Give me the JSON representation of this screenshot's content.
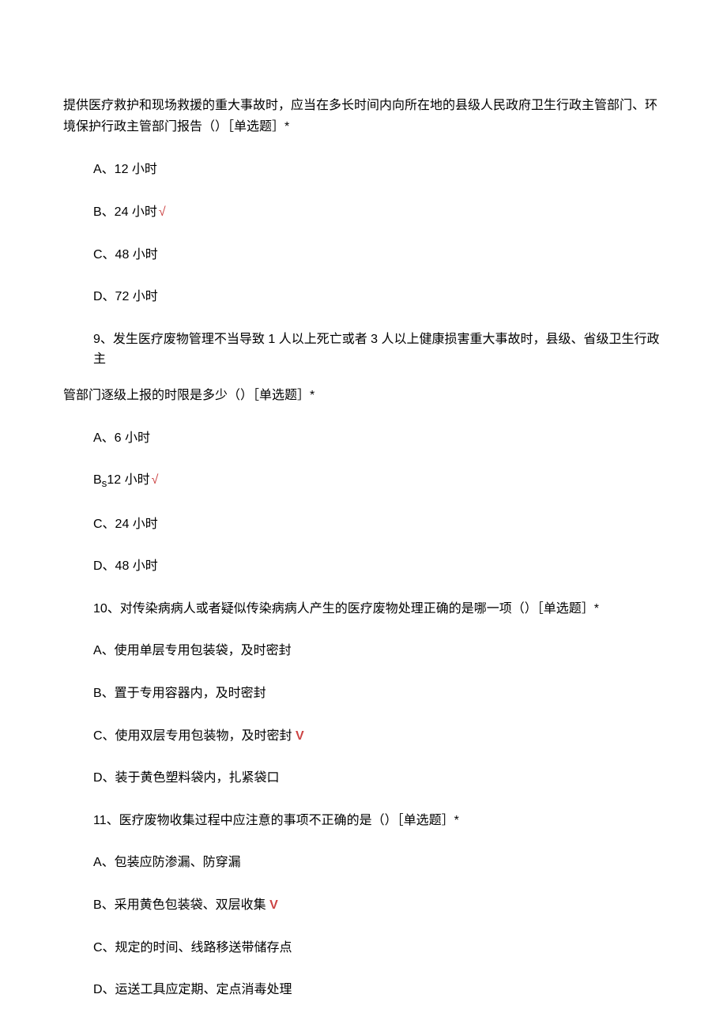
{
  "intro": "提供医疗救护和现场救援的重大事故时，应当在多长时间内向所在地的县级人民政府卫生行政主管部门、环境保护行政主管部门报告（）［单选题］*",
  "q8": {
    "optA": "A、12 小时",
    "optB": "B、24 小时",
    "optB_mark": "√",
    "optC": "C、48 小时",
    "optD": "D、72 小时"
  },
  "q9": {
    "stem_line1": "9、发生医疗废物管理不当导致 1 人以上死亡或者 3 人以上健康损害重大事故时，县级、省级卫生行政主",
    "stem_line2": "管部门逐级上报的时限是多少（）［单选题］*",
    "optA": "A、6 小时",
    "optB_prefix": "B",
    "optB_sub": "s",
    "optB_text": "12 小时",
    "optB_mark": "√",
    "optC": "C、24 小时",
    "optD": "D、48 小时"
  },
  "q10": {
    "stem": "10、对传染病病人或者疑似传染病病人产生的医疗废物处理正确的是哪一项（）［单选题］*",
    "optA": "A、使用单层专用包装袋，及时密封",
    "optB": "B、置于专用容器内，及时密封",
    "optC": "C、使用双层专用包装物，及时密封",
    "optC_mark": " V",
    "optD": "D、装于黄色塑料袋内，扎紧袋口"
  },
  "q11": {
    "stem": "11、医疗废物收集过程中应注意的事项不正确的是（）［单选题］*",
    "optA": "A、包装应防渗漏、防穿漏",
    "optB": "B、采用黄色包装袋、双层收集",
    "optB_mark": " V",
    "optC": "C、规定的时间、线路移送带储存点",
    "optD": "D、运送工具应定期、定点消毒处理"
  }
}
